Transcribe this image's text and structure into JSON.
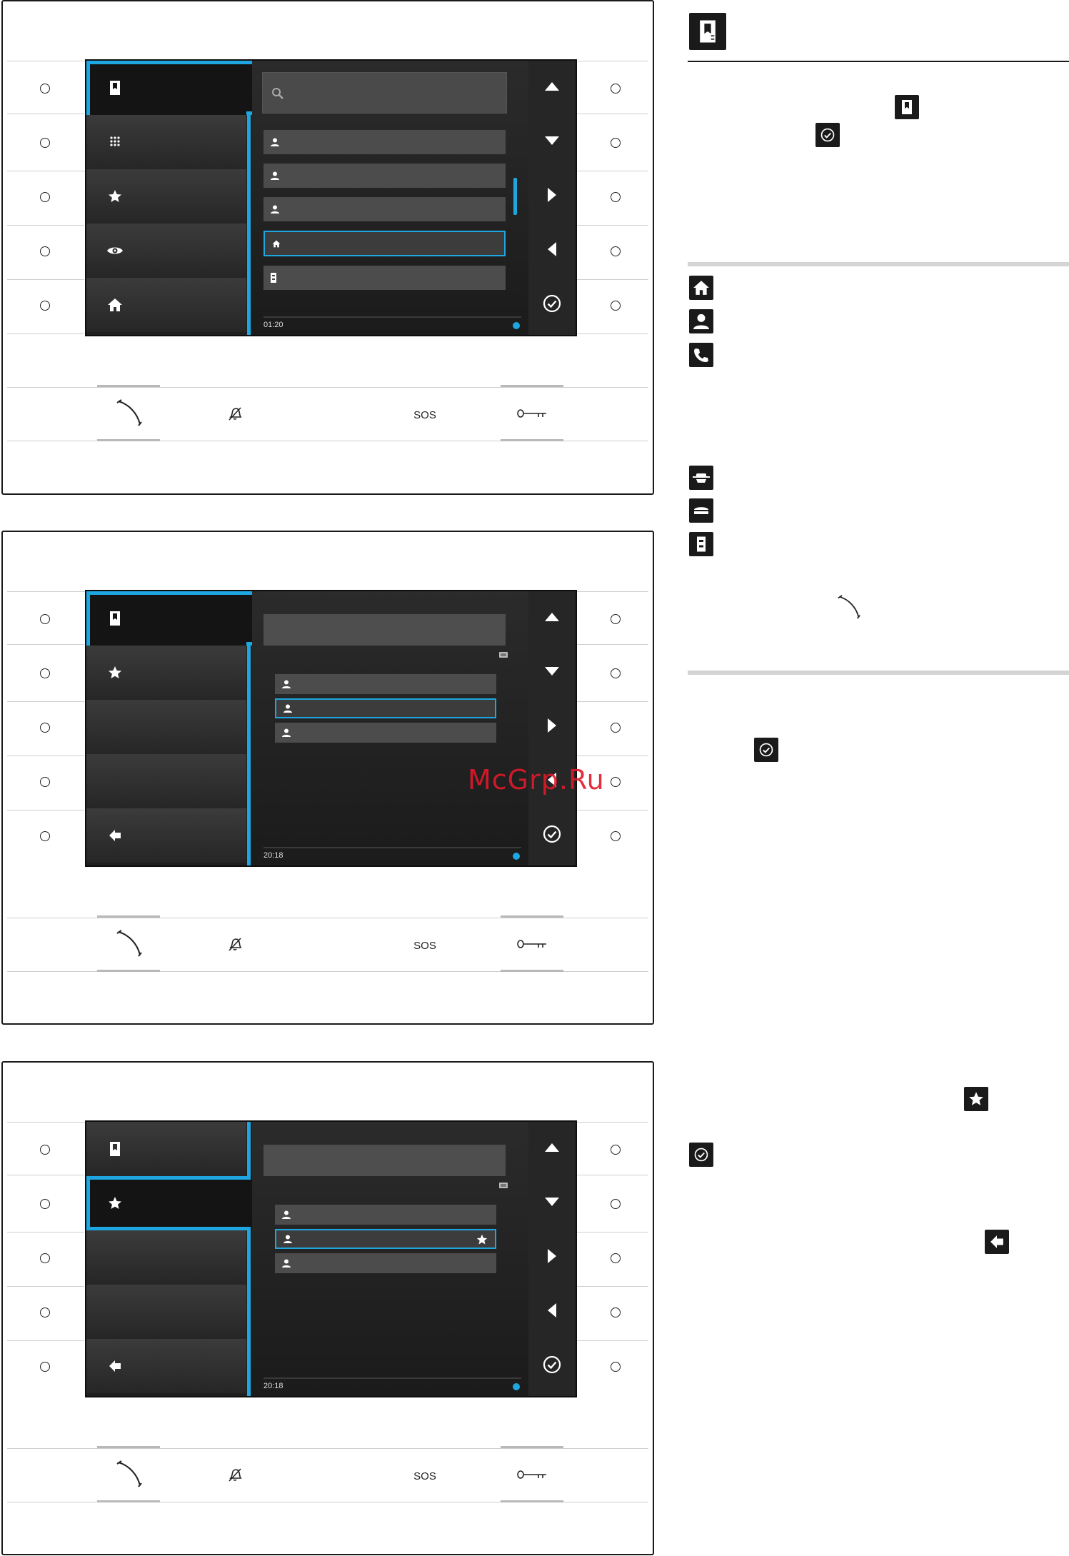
{
  "watermark": "McGrp.Ru",
  "screens": [
    {
      "time": "01:20"
    },
    {
      "time": "20:18"
    },
    {
      "time": "20:18"
    }
  ],
  "colors": {
    "accent": "#1ea6e0",
    "screen_bg": "#1f1f1f",
    "watermark": "#e0192a"
  },
  "bottom_labels": {
    "sos": "SOS"
  },
  "icons": [
    "phonebook-icon",
    "keypad-icon",
    "star-icon",
    "eye-icon",
    "home-icon",
    "back-icon",
    "search-icon",
    "person-icon",
    "door-unit-icon",
    "up-icon",
    "down-icon",
    "right-icon",
    "left-icon",
    "check-icon",
    "handset-icon",
    "bell-off-icon",
    "key-icon",
    "phone-icon",
    "guard-icon",
    "cap-icon"
  ]
}
